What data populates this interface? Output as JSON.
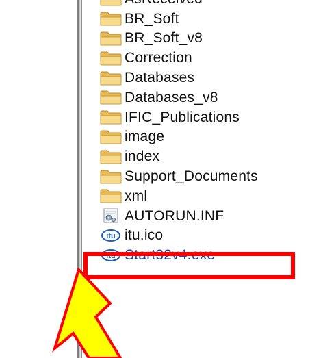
{
  "files": [
    {
      "name": "AsReceived",
      "type": "folder-icon"
    },
    {
      "name": "BR_Soft",
      "type": "folder-icon"
    },
    {
      "name": "BR_Soft_v8",
      "type": "folder-icon"
    },
    {
      "name": "Correction",
      "type": "folder-icon"
    },
    {
      "name": "Databases",
      "type": "folder-icon"
    },
    {
      "name": "Databases_v8",
      "type": "folder-icon"
    },
    {
      "name": "IFIC_Publications",
      "type": "folder-icon"
    },
    {
      "name": "image",
      "type": "folder-icon"
    },
    {
      "name": "index",
      "type": "folder-icon"
    },
    {
      "name": "Support_Documents",
      "type": "folder-icon"
    },
    {
      "name": "xml",
      "type": "folder-icon"
    },
    {
      "name": "AUTORUN.INF",
      "type": "settings-file-icon"
    },
    {
      "name": "itu.ico",
      "type": "itu-logo-icon"
    },
    {
      "name": "Start32v4.exe",
      "type": "itu-logo-icon"
    }
  ],
  "colors": {
    "folder": "#f3d27a",
    "highlight": "#ff0000",
    "arrow_fill": "#ffff00",
    "arrow_stroke": "#ff0000",
    "exe_text": "#1b3f9e"
  }
}
